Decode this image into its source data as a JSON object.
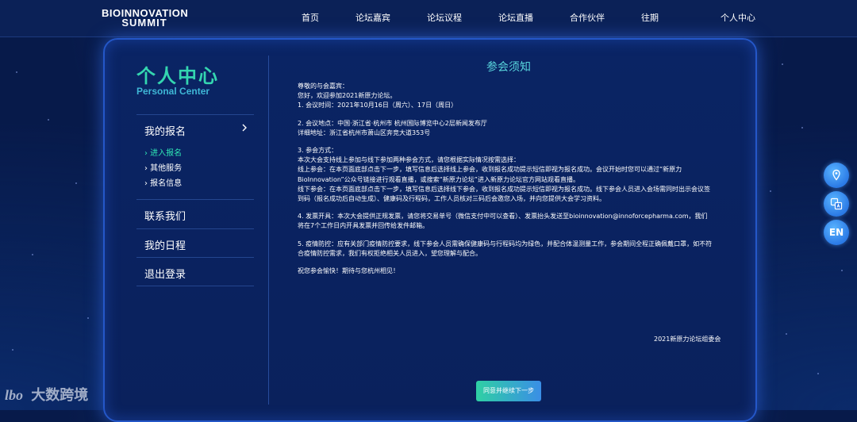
{
  "header": {
    "logo_line1": "BIOINNOVATION",
    "logo_line2": "SUMMIT",
    "nav": [
      "首页",
      "论坛嘉宾",
      "论坛议程",
      "论坛直播",
      "合作伙伴",
      "往期"
    ],
    "personal": "个人中心"
  },
  "sidebar": {
    "title": "个人中心",
    "subtitle": "Personal Center",
    "my_registration": "我的报名",
    "sub_items": [
      "› 进入报名",
      "› 其他服务",
      "› 报名信息"
    ],
    "contact": "联系我们",
    "schedule": "我的日程",
    "logout": "退出登录"
  },
  "notice": {
    "title": "参会须知",
    "lines": [
      "尊敬的与会嘉宾：",
      "您好，欢迎参加2021新原力论坛。",
      "1. 会议时间：2021年10月16日（周六）、17日（周日）",
      "",
      "2. 会议地点：中国·浙江省·杭州市 杭州国际博览中心2层新闻发布厅",
      "详细地址：浙江省杭州市萧山区奔竞大道353号",
      "",
      "3. 参会方式：",
      "本次大会支持线上参加与线下参加两种参会方式，请您根据实际情况按需选择：",
      "线上参会：在本页面底部点击下一步，填写信息后选择线上参会，收到报名成功提示短信即视为报名成功。会议开始时您可以通过“新原力",
      "BioInnovation”公众号链接进行观看直播，或搜索“新原力论坛”进入新原力论坛官方网站观看直播。",
      "线下参会：在本页面底部点击下一步，填写信息后选择线下参会，收到报名成功提示短信即视为报名成功。线下参会人员进入会场需同时出示会议签",
      "到码（报名成功后自动生成）、健康码及行程码，工作人员核对三码后会邀您入场，并向您提供大会学习资料。",
      "",
      "4. 发票开具：本次大会提供正规发票，请您将交易单号（微信支付中可以查看）、发票抬头发送至bioinnovation@innoforcepharma.com，我们",
      "将在7个工作日内开具发票并回传给发件邮箱。",
      "",
      "5. 疫情防控：应有关部门疫情防控要求，线下参会人员需确保健康码与行程码均为绿色，并配合体温测量工作，参会期间全程正确佩戴口罩，如不符",
      "合疫情防控需求，我们有权拒绝相关人员进入，望您理解与配合。",
      "",
      "祝您参会愉快！期待与您杭州相见！"
    ],
    "signature": "2021新原力论坛组委会",
    "button": "同意并继续下一步"
  },
  "floating": {
    "en_label": "EN",
    "icons": [
      "location-icon",
      "translate-icon",
      "language-en-icon"
    ]
  },
  "watermark": {
    "logo": "lbo",
    "text": "大数跨境"
  },
  "colors": {
    "accent_green": "#2fe5b4",
    "accent_cyan": "#58d4dc",
    "panel_border": "#2457c8",
    "background": "#071a4a"
  }
}
